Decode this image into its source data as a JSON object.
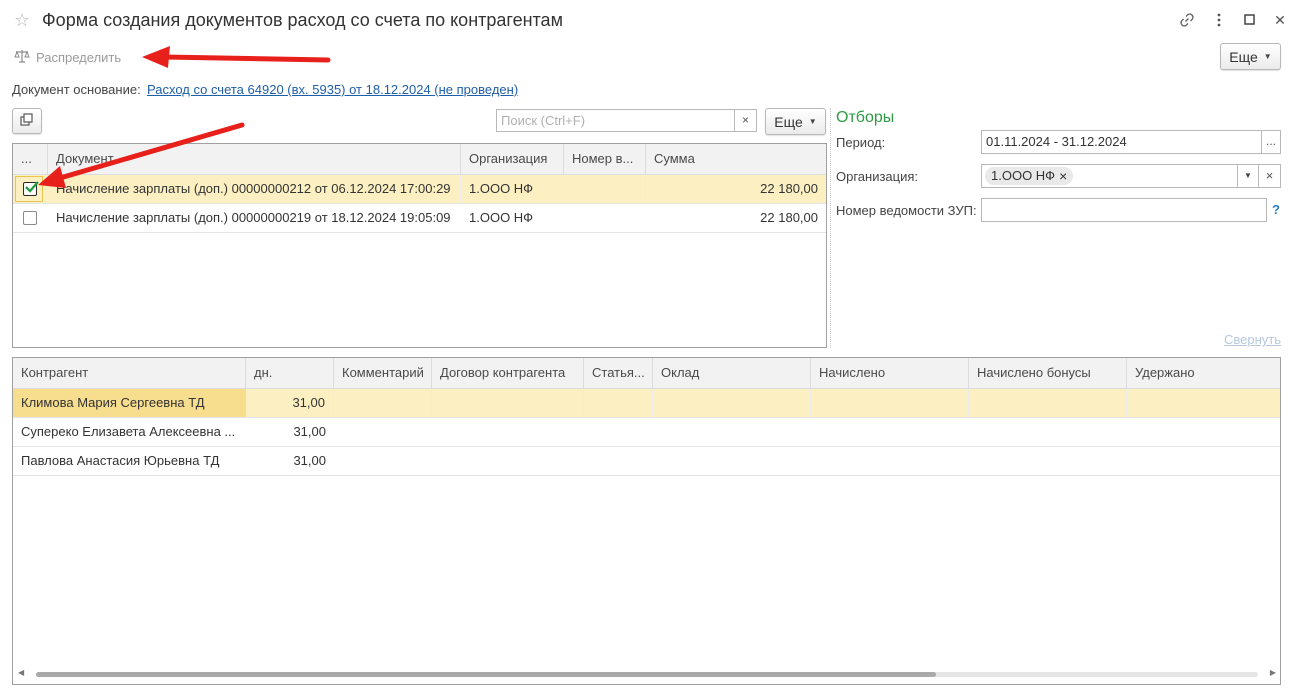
{
  "window": {
    "title": "Форма создания документов расход со счета по контрагентам",
    "link_icon": "link-icon",
    "menu_icon": "more-vertical-icon",
    "maximize_icon": "maximize-icon",
    "close_glyph": "✕",
    "star_glyph": "☆"
  },
  "toolbar": {
    "distribute_label": "Распределить",
    "more_label": "Еще"
  },
  "basis": {
    "label": "Документ основание:",
    "link": "Расход со счета 64920 (вх. 5935) от 18.12.2024 (не проведен)"
  },
  "search": {
    "placeholder": "Поиск (Ctrl+F)",
    "value": "",
    "clear_glyph": "×",
    "more_label": "Еще"
  },
  "docs_table": {
    "columns": [
      "...",
      "Документ",
      "Организация",
      "Номер в...",
      "Сумма"
    ],
    "rows": [
      {
        "checked": true,
        "document": "Начисление зарплаты (доп.) 00000000212 от 06.12.2024 17:00:29",
        "org": "1.ООО НФ",
        "number": "",
        "sum": "22 180,00"
      },
      {
        "checked": false,
        "document": "Начисление зарплаты (доп.) 00000000219 от 18.12.2024 19:05:09",
        "org": "1.ООО НФ",
        "number": "",
        "sum": "22 180,00"
      }
    ]
  },
  "filters": {
    "title": "Отборы",
    "period_label": "Период:",
    "period_value": "01.11.2024 - 31.12.2024",
    "period_button": "...",
    "org_label": "Организация:",
    "org_chip": "1.ООО НФ",
    "org_chip_remove": "×",
    "org_clear": "×",
    "zup_label": "Номер ведомости ЗУП:",
    "zup_value": "",
    "help": "?",
    "collapse_link": "Свернуть"
  },
  "contractors_table": {
    "columns": [
      "Контрагент",
      "дн.",
      "Комментарий",
      "Договор контрагента",
      "Статья...",
      "Оклад",
      "Начислено",
      "Начислено бонусы",
      "Удержано"
    ],
    "rows": [
      {
        "name": "Климова Мария Сергеевна ТД",
        "days": "31,00"
      },
      {
        "name": "Супереко Елизавета Алексеевна ...",
        "days": "31,00"
      },
      {
        "name": "Павлова Анастасия Юрьевна ТД",
        "days": "31,00"
      }
    ]
  },
  "colors": {
    "selected_row": "#fcf0c3",
    "link": "#1f5ea8",
    "filters_title": "#2e9a43",
    "annotation_arrow": "#e8201c",
    "checkmark": "#1c9a3f"
  }
}
